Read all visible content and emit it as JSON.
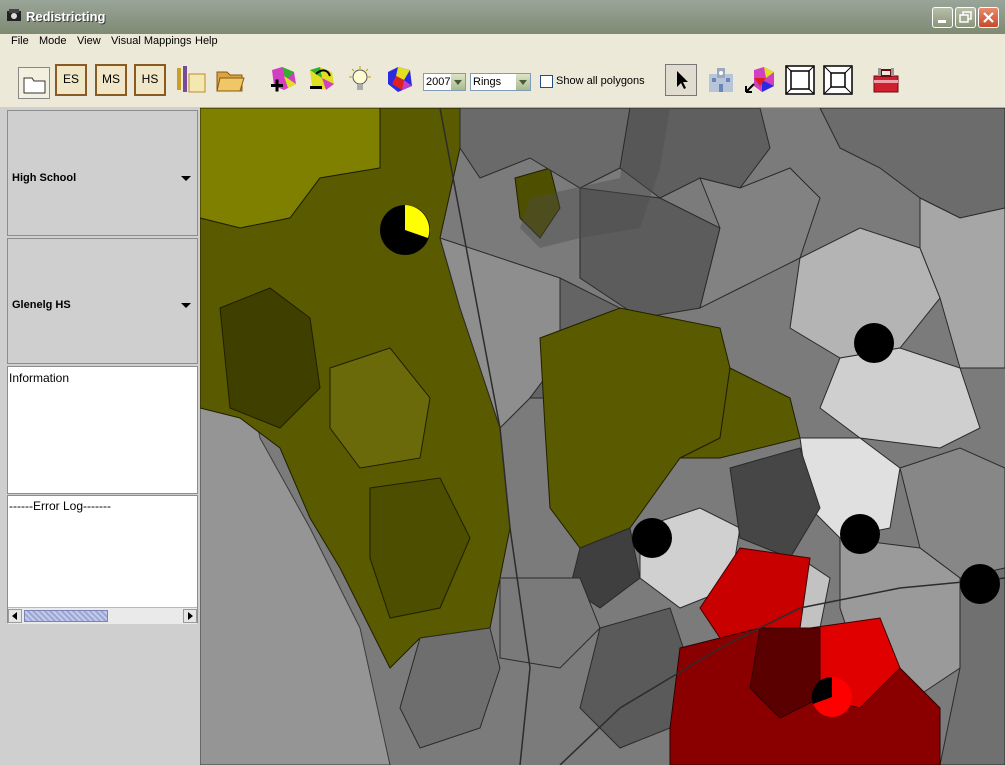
{
  "window": {
    "title": "Redistricting"
  },
  "menu": [
    "File",
    "Mode",
    "View",
    "Visual Mappings",
    "Help"
  ],
  "toolbar": {
    "school_buttons": [
      "ES",
      "MS",
      "HS"
    ],
    "year": "2007",
    "view_mode": "Rings",
    "show_all_polygons_label": "Show all polygons",
    "show_all_polygons_checked": false
  },
  "left_panel": {
    "level_select": "High School",
    "school_select": "Glenelg HS",
    "information_text": "Information",
    "error_log_text": "------Error Log-------"
  },
  "map": {
    "colors": {
      "selected_district": "#5a5a00",
      "outer_district": "#7f7f00",
      "highlight_district": "#c80000",
      "school_marker": "#000000",
      "pie_yellow": "#ffff00",
      "pie_red": "#ff0000"
    }
  }
}
